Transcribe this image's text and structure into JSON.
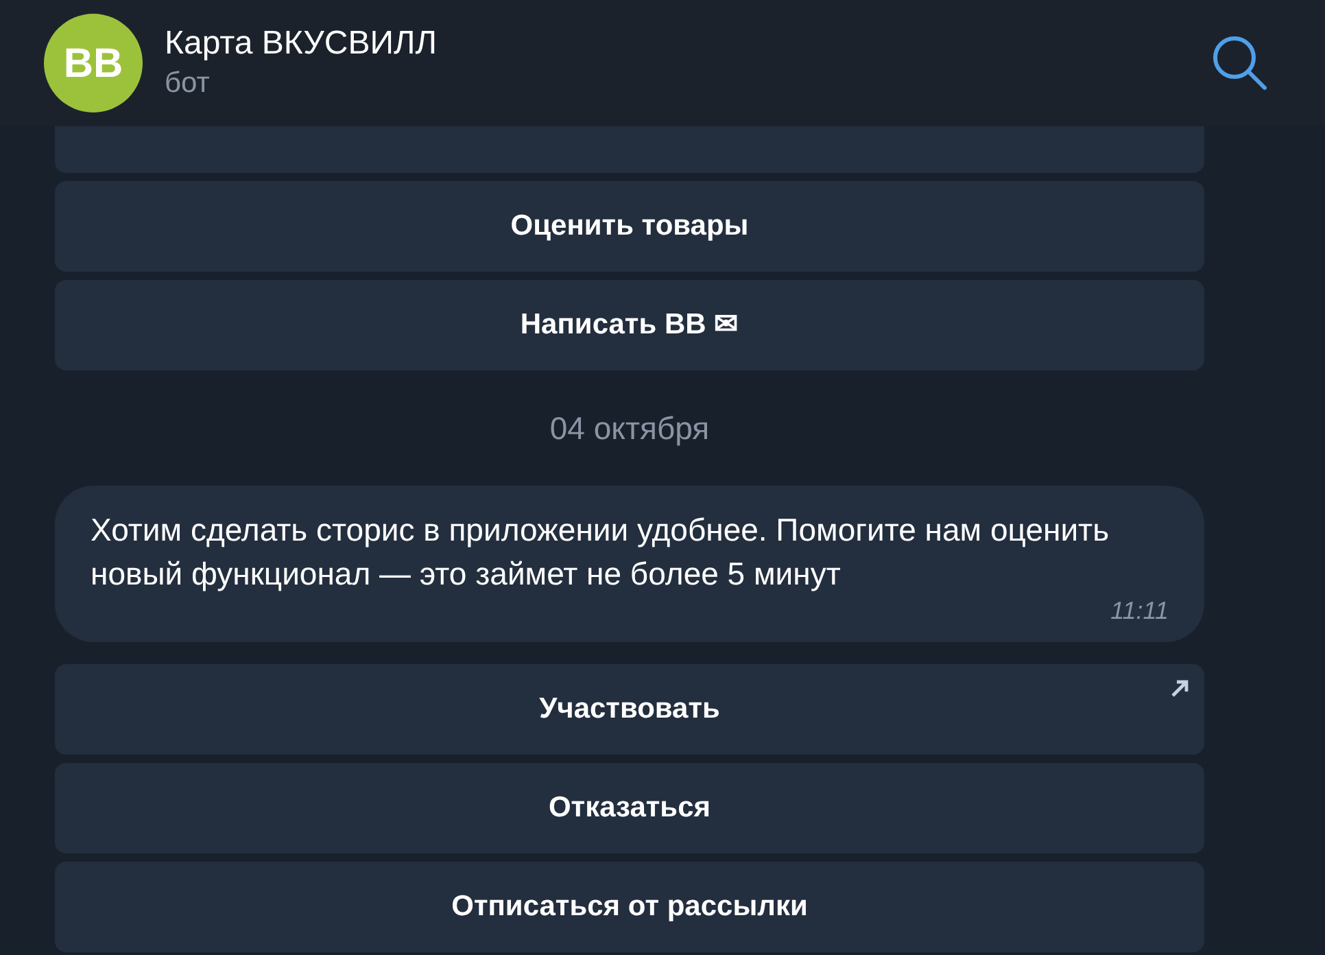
{
  "header": {
    "avatar_text": "BB",
    "title": "Карта ВКУСВИЛЛ",
    "subtitle": "бот"
  },
  "keyboard_top_cut_off": true,
  "keyboard_top": [
    {
      "label": "Оценить товары",
      "opens_link": false
    },
    {
      "label": "Написать ВВ ✉",
      "opens_link": false
    }
  ],
  "date": "04 октября",
  "message": {
    "text": "Хотим сделать сторис в приложении удобнее. Помогите нам оценить новый функционал — это займет не более 5 минут",
    "time": "11:11"
  },
  "keyboard_bottom": [
    {
      "label": "Участвовать",
      "opens_link": true
    },
    {
      "label": "Отказаться",
      "opens_link": false
    },
    {
      "label": "Отписаться от рассылки",
      "opens_link": false
    }
  ]
}
